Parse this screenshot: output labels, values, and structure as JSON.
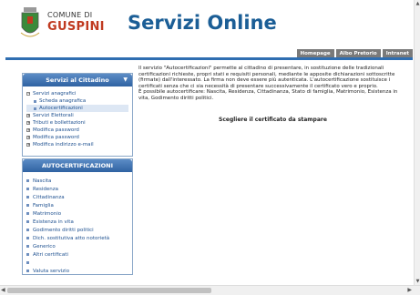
{
  "header": {
    "logo_small": "COMUNE DI",
    "logo_big": "GUSPINI",
    "title": "Servizi Online"
  },
  "topnav": [
    "Homepage",
    "Albo Pretorio",
    "Intranet"
  ],
  "sidebar": {
    "panel_title": "Servizi al Cittadino",
    "dropdown_glyph": "▼",
    "items": [
      {
        "label": "Servizi anagrafici",
        "level": 0,
        "toggle": "−"
      },
      {
        "label": "Scheda anagrafica",
        "level": 1
      },
      {
        "label": "Autocertificazioni",
        "level": 1,
        "active": true
      },
      {
        "label": "Servizi Elettorali",
        "level": 0,
        "toggle": "+"
      },
      {
        "label": "Tributi e bollettazioni",
        "level": 0,
        "toggle": "+"
      },
      {
        "label": "Modifica password",
        "level": 0,
        "toggle": "+"
      },
      {
        "label": "Modifica password",
        "level": 0,
        "toggle": "+"
      },
      {
        "label": "Modifica indirizzo e-mail",
        "level": 0,
        "toggle": "+"
      }
    ]
  },
  "autocert": {
    "title": "AUTOCERTIFICAZIONI",
    "items": [
      "Nascita",
      "Residenza",
      "Cittadinanza",
      "Famiglia",
      "Matrimonio",
      "Esistenza in vita",
      "Godimento diritti politici",
      "Dich. sostitutiva atto notorietà",
      "Generico",
      "Altri certificati",
      "",
      "Valuta servizio"
    ]
  },
  "content": {
    "paragraph": "Il servizio \"Autocertificazioni\" permette al cittadino di presentare, in sostituzione delle tradizionali certificazioni richieste, propri stati e requisiti personali, mediante le apposite dichiarazioni sottoscritte (firmate) dall'interessato. La firma non deve essere più autenticata. L'autocertificazione sostituisce i certificati senza che ci sia necessità di presentare successivamente il certificato vero e proprio.",
    "line2": "È possibile autocertificare: Nascita, Residenza, Cittadinanza, Stato di famiglia, Matrimonio, Esistenza in vita, Godimento diritti politici.",
    "cta": "Scegliere il certificato da stampare"
  },
  "colors": {
    "brand_blue": "#1b5e96",
    "logo_red": "#c03a20",
    "panel_blue": "#2f62a2"
  }
}
